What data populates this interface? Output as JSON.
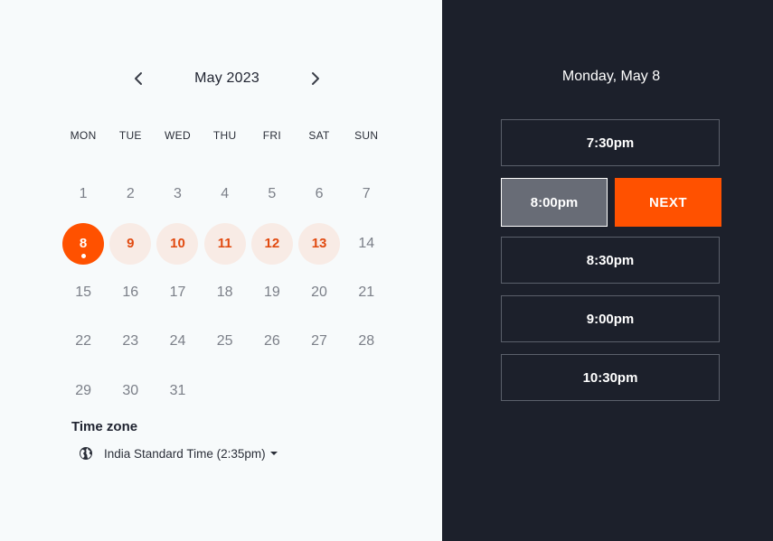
{
  "calendar": {
    "month_label": "May 2023",
    "prev_icon": "chevron-left-icon",
    "next_icon": "chevron-right-icon",
    "weekdays": [
      "MON",
      "TUE",
      "WED",
      "THU",
      "FRI",
      "SAT",
      "SUN"
    ],
    "weeks": [
      [
        {
          "d": "1",
          "s": "default"
        },
        {
          "d": "2",
          "s": "default"
        },
        {
          "d": "3",
          "s": "default"
        },
        {
          "d": "4",
          "s": "default"
        },
        {
          "d": "5",
          "s": "default"
        },
        {
          "d": "6",
          "s": "default"
        },
        {
          "d": "7",
          "s": "default"
        }
      ],
      [
        {
          "d": "8",
          "s": "selected"
        },
        {
          "d": "9",
          "s": "available"
        },
        {
          "d": "10",
          "s": "available"
        },
        {
          "d": "11",
          "s": "available"
        },
        {
          "d": "12",
          "s": "available"
        },
        {
          "d": "13",
          "s": "available"
        },
        {
          "d": "14",
          "s": "default"
        }
      ],
      [
        {
          "d": "15",
          "s": "default"
        },
        {
          "d": "16",
          "s": "default"
        },
        {
          "d": "17",
          "s": "default"
        },
        {
          "d": "18",
          "s": "default"
        },
        {
          "d": "19",
          "s": "default"
        },
        {
          "d": "20",
          "s": "default"
        },
        {
          "d": "21",
          "s": "default"
        }
      ],
      [
        {
          "d": "22",
          "s": "default"
        },
        {
          "d": "23",
          "s": "default"
        },
        {
          "d": "24",
          "s": "default"
        },
        {
          "d": "25",
          "s": "default"
        },
        {
          "d": "26",
          "s": "default"
        },
        {
          "d": "27",
          "s": "default"
        },
        {
          "d": "28",
          "s": "default"
        }
      ],
      [
        {
          "d": "29",
          "s": "default"
        },
        {
          "d": "30",
          "s": "default"
        },
        {
          "d": "31",
          "s": "default"
        },
        {
          "d": "",
          "s": "empty"
        },
        {
          "d": "",
          "s": "empty"
        },
        {
          "d": "",
          "s": "empty"
        },
        {
          "d": "",
          "s": "empty"
        }
      ]
    ]
  },
  "timezone": {
    "title": "Time zone",
    "icon": "globe-icon",
    "value": "India Standard Time (2:35pm)",
    "caret_icon": "caret-down-icon"
  },
  "schedule": {
    "date_title": "Monday, May 8",
    "slots": [
      {
        "time": "7:30pm",
        "selected": false
      },
      {
        "time": "8:00pm",
        "selected": true
      },
      {
        "time": "8:30pm",
        "selected": false
      },
      {
        "time": "9:00pm",
        "selected": false
      },
      {
        "time": "10:30pm",
        "selected": false
      }
    ],
    "next_label": "NEXT"
  },
  "colors": {
    "accent": "#ff5100",
    "available_bg": "#f8ebe5",
    "panel_dark": "#1c202b",
    "panel_light": "#f7fafb"
  }
}
